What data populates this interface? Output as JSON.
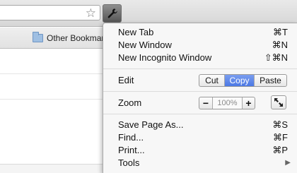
{
  "bookmarks_bar": {
    "items": [
      {
        "label": "Other Bookmarks",
        "icon": "folder-icon"
      }
    ]
  },
  "toolbar": {
    "star_icon": "☆",
    "menu_icon": "wrench-icon"
  },
  "menu": {
    "items_top": [
      {
        "label": "New Tab",
        "shortcut": "⌘T"
      },
      {
        "label": "New Window",
        "shortcut": "⌘N"
      },
      {
        "label": "New Incognito Window",
        "shortcut": "⇧⌘N"
      }
    ],
    "edit": {
      "label": "Edit",
      "cut": "Cut",
      "copy": "Copy",
      "paste": "Paste"
    },
    "zoom": {
      "label": "Zoom",
      "minus": "−",
      "value": "100%",
      "plus": "+"
    },
    "items_bottom": [
      {
        "label": "Save Page As...",
        "shortcut": "⌘S"
      },
      {
        "label": "Find...",
        "shortcut": "⌘F"
      },
      {
        "label": "Print...",
        "shortcut": "⌘P"
      }
    ],
    "tools": {
      "label": "Tools",
      "arrow": "▶"
    }
  },
  "colors": {
    "accent": "#5b84ea",
    "menu_bg": "#f7f7f7"
  }
}
